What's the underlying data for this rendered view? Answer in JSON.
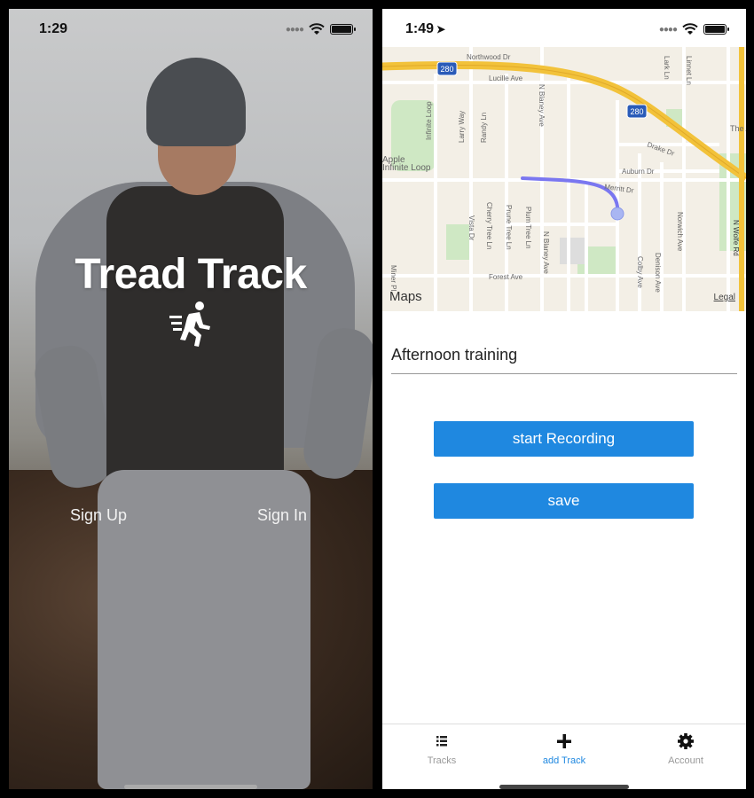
{
  "left_screen": {
    "status_time": "1:29",
    "title": "Tread Track",
    "links": {
      "sign_up": "Sign Up",
      "sign_in": "Sign In"
    }
  },
  "right_screen": {
    "status_time": "1:49",
    "map": {
      "attribution": "Maps",
      "legal": "Legal",
      "labels": [
        "Northwood Dr",
        "280",
        "Lucille Ave",
        "Infinite Loop",
        "Larry Way",
        "Randy Ln",
        "N Blaney Ave",
        "Apple",
        "Infinite Loop",
        "Drake Dr",
        "Auburn Dr",
        "Merritt Dr",
        "Cherry Tree Ln",
        "Prune Tree Ln",
        "Vista Dr",
        "Plum Tree Ln",
        "N Blaney Ave",
        "Forest Ave",
        "Colby Ave",
        "Denison Ave",
        "Norwich Ave",
        "Lark Ln",
        "Linnet Ln",
        "N Wolfe Rd",
        "Miner Pl",
        "280",
        "The Apa"
      ]
    },
    "track_name_value": "Afternoon training",
    "buttons": {
      "start": "start Recording",
      "save": "save"
    },
    "tabs": [
      {
        "label": "Tracks",
        "icon": "list-icon"
      },
      {
        "label": "add Track",
        "icon": "plus-icon"
      },
      {
        "label": "Account",
        "icon": "gear-icon"
      }
    ],
    "accent_color": "#1f88e0"
  }
}
